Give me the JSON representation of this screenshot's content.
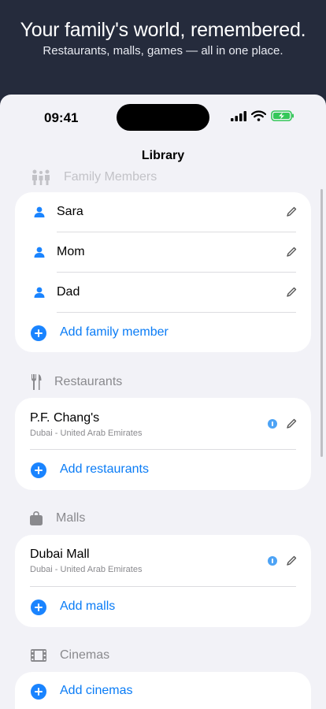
{
  "banner": {
    "title": "Your family's world, remembered.",
    "subtitle": "Restaurants, malls, games — all in one place."
  },
  "status_bar": {
    "time": "09:41"
  },
  "nav": {
    "title": "Library"
  },
  "family": {
    "header": "Family Members",
    "members": [
      "Sara",
      "Mom",
      "Dad"
    ],
    "add_label": "Add family member"
  },
  "restaurants": {
    "header": "Restaurants",
    "items": [
      {
        "name": "P.F. Chang's",
        "location": "Dubai - United Arab Emirates"
      }
    ],
    "add_label": "Add restaurants"
  },
  "malls": {
    "header": "Malls",
    "items": [
      {
        "name": "Dubai Mall",
        "location": "Dubai - United Arab Emirates"
      }
    ],
    "add_label": "Add malls"
  },
  "cinemas": {
    "header": "Cinemas",
    "add_label": "Add cinemas"
  },
  "colors": {
    "accent": "#0a7cf6",
    "banner_bg": "#252b3c",
    "page_bg": "#f2f2f7",
    "battery": "#34c759"
  }
}
